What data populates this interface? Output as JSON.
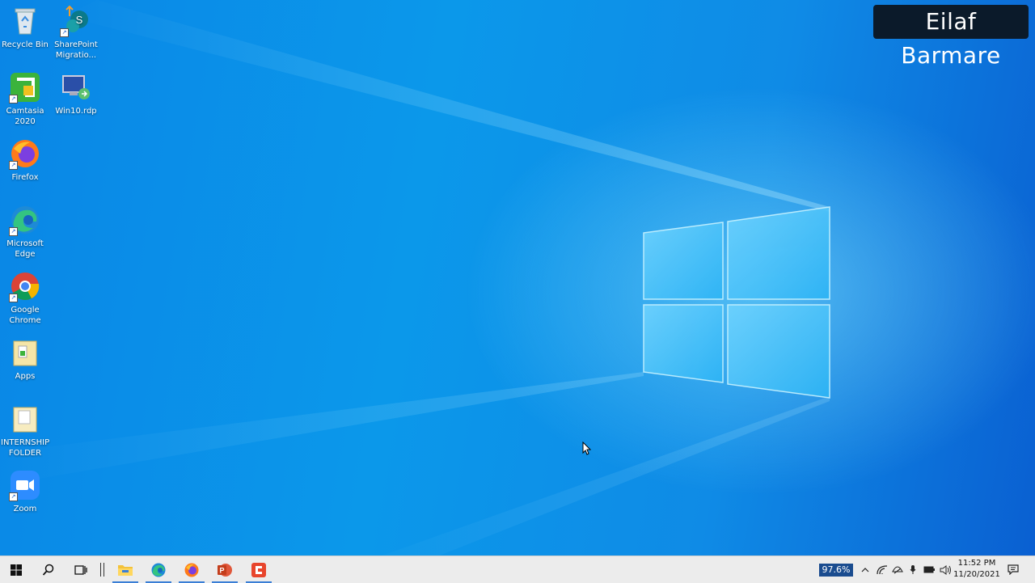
{
  "desktop": {
    "icons": [
      {
        "label": "Recycle Bin",
        "icon": "recycle-bin-icon"
      },
      {
        "label": "SharePoint Migratio...",
        "icon": "sharepoint-migration-icon"
      },
      {
        "label": "Camtasia 2020",
        "icon": "camtasia-icon"
      },
      {
        "label": "Win10.rdp",
        "icon": "remote-desktop-icon"
      },
      {
        "label": "Firefox",
        "icon": "firefox-icon"
      },
      {
        "label": "Microsoft Edge",
        "icon": "edge-icon"
      },
      {
        "label": "Google Chrome",
        "icon": "chrome-icon"
      },
      {
        "label": "Apps",
        "icon": "folder-icon"
      },
      {
        "label": "INTERNSHIP FOLDER",
        "icon": "folder-icon"
      },
      {
        "label": "Zoom",
        "icon": "zoom-icon"
      }
    ]
  },
  "watermark": {
    "text": "Eilaf Barmare"
  },
  "taskbar": {
    "buttons": [
      "start-icon",
      "search-icon",
      "task-view-icon",
      "file-explorer-icon",
      "edge-icon",
      "firefox-icon",
      "powerpoint-icon",
      "camtasia-icon"
    ],
    "tray": {
      "zoom_level": "97.6%",
      "time": "11:52 PM",
      "date": "11/20/2021"
    }
  },
  "colors": {
    "accent": "#3b7fd6",
    "watermark_bg": "#0b1a2a"
  }
}
